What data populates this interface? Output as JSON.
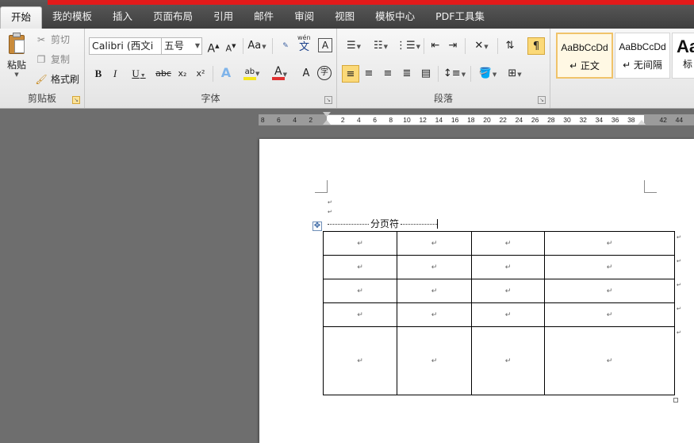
{
  "tabs": [
    {
      "label": "开始",
      "active": true
    },
    {
      "label": "我的模板"
    },
    {
      "label": "插入"
    },
    {
      "label": "页面布局"
    },
    {
      "label": "引用"
    },
    {
      "label": "邮件"
    },
    {
      "label": "审阅"
    },
    {
      "label": "视图"
    },
    {
      "label": "模板中心"
    },
    {
      "label": "PDF工具集"
    }
  ],
  "clipboard": {
    "paste_label": "粘贴",
    "cut_label": "剪切",
    "copy_label": "复制",
    "format_painter_label": "格式刷",
    "group_label": "剪贴板"
  },
  "font": {
    "font_name": "Calibri (西文i",
    "font_size": "五号",
    "group_label": "字体",
    "aa_label": "Aa",
    "bold": "B",
    "italic": "I",
    "underline": "U",
    "strike": "abc",
    "subscript": "x₂",
    "superscript": "x²",
    "grow": "A",
    "shrink": "A",
    "font_color_letter": "A",
    "char_shading_letter": "A",
    "highlight_letters": "ab",
    "phonetic_letters": "wén",
    "phonetic_char": "文",
    "circle_char": "字",
    "border_char": "A",
    "text_effect_letter": "A",
    "highlight_color": "#f5e61d",
    "font_color": "#e03030"
  },
  "paragraph": {
    "group_label": "段落"
  },
  "styles": [
    {
      "sample": "AaBbCcDd",
      "name": "↵ 正文",
      "selected": true
    },
    {
      "sample": "AaBbCcDd",
      "name": "↵ 无间隔"
    },
    {
      "sample": "Aa",
      "name": "标"
    }
  ],
  "ruler": {
    "left_numbers": [
      "8",
      "6",
      "4",
      "2"
    ],
    "right_numbers": [
      "2",
      "4",
      "6",
      "8",
      "10",
      "12",
      "14",
      "16",
      "18",
      "20",
      "22",
      "24",
      "26",
      "28",
      "30",
      "32",
      "34",
      "36",
      "38"
    ],
    "far_numbers": [
      "42",
      "44"
    ]
  },
  "document": {
    "page_break_text": "分页符",
    "cell_mark": "↵",
    "para_mark": "↵",
    "table_handle_glyph": "✥",
    "row_heights": [
      30,
      30,
      30,
      30,
      86
    ],
    "col_widths": [
      93,
      94,
      92,
      164
    ]
  }
}
